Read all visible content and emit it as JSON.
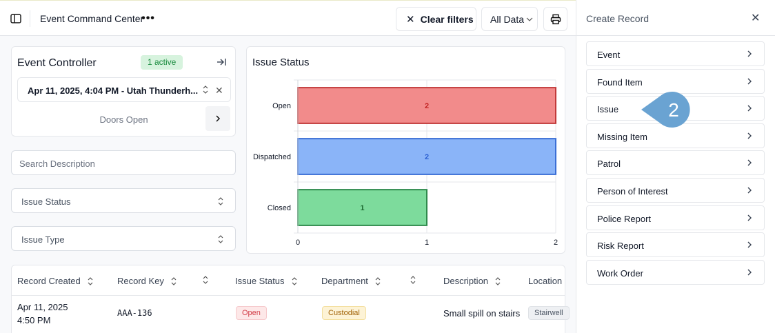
{
  "topbar": {
    "title": "Event Command Center",
    "more_label": "•••",
    "clear_filters_label": "Clear filters",
    "all_data_label": "All Data"
  },
  "controller": {
    "title": "Event Controller",
    "active_badge": "1 active",
    "event_value": "Apr 11, 2025, 4:04 PM - Utah Thunderh...",
    "status_text": "Doors Open"
  },
  "filters": {
    "search_placeholder": "Search Description",
    "issue_status_label": "Issue Status",
    "issue_type_label": "Issue Type"
  },
  "chart_data": {
    "type": "bar",
    "orientation": "horizontal",
    "title": "Issue Status",
    "categories": [
      "Open",
      "Dispatched",
      "Closed"
    ],
    "values": [
      2,
      2,
      1
    ],
    "data_labels": [
      "2",
      "2",
      "1"
    ],
    "colors": [
      "#f28b8b",
      "#8ab4f8",
      "#7ddb9c"
    ],
    "border_colors": [
      "#c23a3a",
      "#3b6fd6",
      "#2f8a4c"
    ],
    "label_colors": [
      "#c22424",
      "#2b5fd1",
      "#1e6b33"
    ],
    "xlim": [
      0,
      2
    ],
    "x_ticks": [
      "0",
      "1",
      "2"
    ],
    "grid": true,
    "xlabel": "",
    "ylabel": ""
  },
  "table": {
    "columns": [
      "Record Created",
      "Record Key",
      "Issue Status",
      "Department",
      "Description",
      "Location"
    ],
    "rows": [
      {
        "created_date": "Apr 11, 2025",
        "created_time": "4:50 PM",
        "key": "AAA-136",
        "status": "Open",
        "department": "Custodial",
        "description": "Small spill on stairs",
        "location": "Stairwell"
      }
    ]
  },
  "panel": {
    "title": "Create Record",
    "items": [
      "Event",
      "Found Item",
      "Issue",
      "Missing Item",
      "Patrol",
      "Person of Interest",
      "Police Report",
      "Risk Report",
      "Work Order"
    ]
  },
  "step_badge": "2",
  "colors": {
    "accent_step": "#6aa3d2",
    "active_badge_bg": "#d7f3de",
    "active_badge_text": "#178a3c"
  }
}
